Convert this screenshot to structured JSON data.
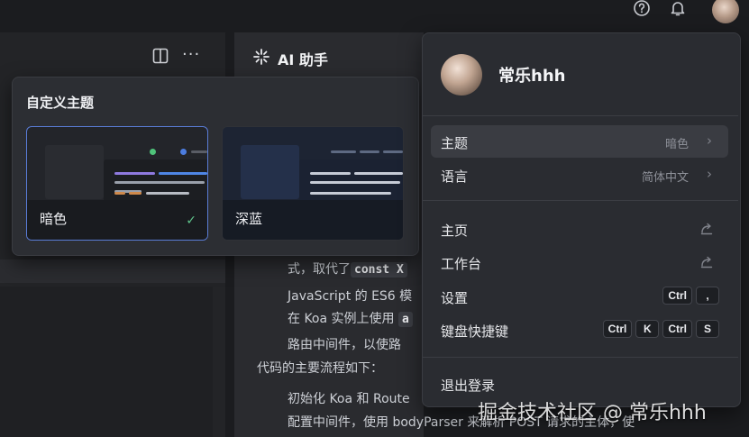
{
  "top_bar": {
    "icons": [
      "help-icon",
      "bell-icon",
      "avatar"
    ]
  },
  "editor": {
    "icons": [
      "layout-split-icon",
      "more-icon"
    ],
    "more_glyph": "···"
  },
  "ai_panel": {
    "title": "AI 助手",
    "lines": [
      "式，取代了",
      "JavaScript 的 ES6 模",
      "在 Koa 实例上使用",
      "路由中间件，以使路",
      "代码的主要流程如下：",
      "初始化 Koa 和 Route",
      "配置中间件，使用 bodyParser 来解析 POST 请求的主体，使"
    ],
    "code_1": "const X",
    "code_2": "a"
  },
  "theme_popover": {
    "title": "自定义主题",
    "cards": [
      {
        "label": "暗色",
        "selected": true,
        "check": "✓"
      },
      {
        "label": "深蓝",
        "selected": false
      }
    ]
  },
  "user_menu": {
    "username": "常乐hhh",
    "theme": {
      "label": "主题",
      "value": "暗色",
      "chevron": "›"
    },
    "language": {
      "label": "语言",
      "value": "简体中文",
      "chevron": "›"
    },
    "home": {
      "label": "主页"
    },
    "workbench": {
      "label": "工作台"
    },
    "settings": {
      "label": "设置",
      "keys": [
        "Ctrl",
        ","
      ]
    },
    "shortcuts": {
      "label": "键盘快捷键",
      "keys": [
        "Ctrl",
        "K",
        "Ctrl",
        "S"
      ]
    },
    "logout": {
      "label": "退出登录"
    }
  },
  "watermark": "掘金技术社区 @ 常乐hhh",
  "colors": {
    "accent_border": "#5a7cd6",
    "check": "#5fc48b",
    "background": "#1b1c1f"
  }
}
